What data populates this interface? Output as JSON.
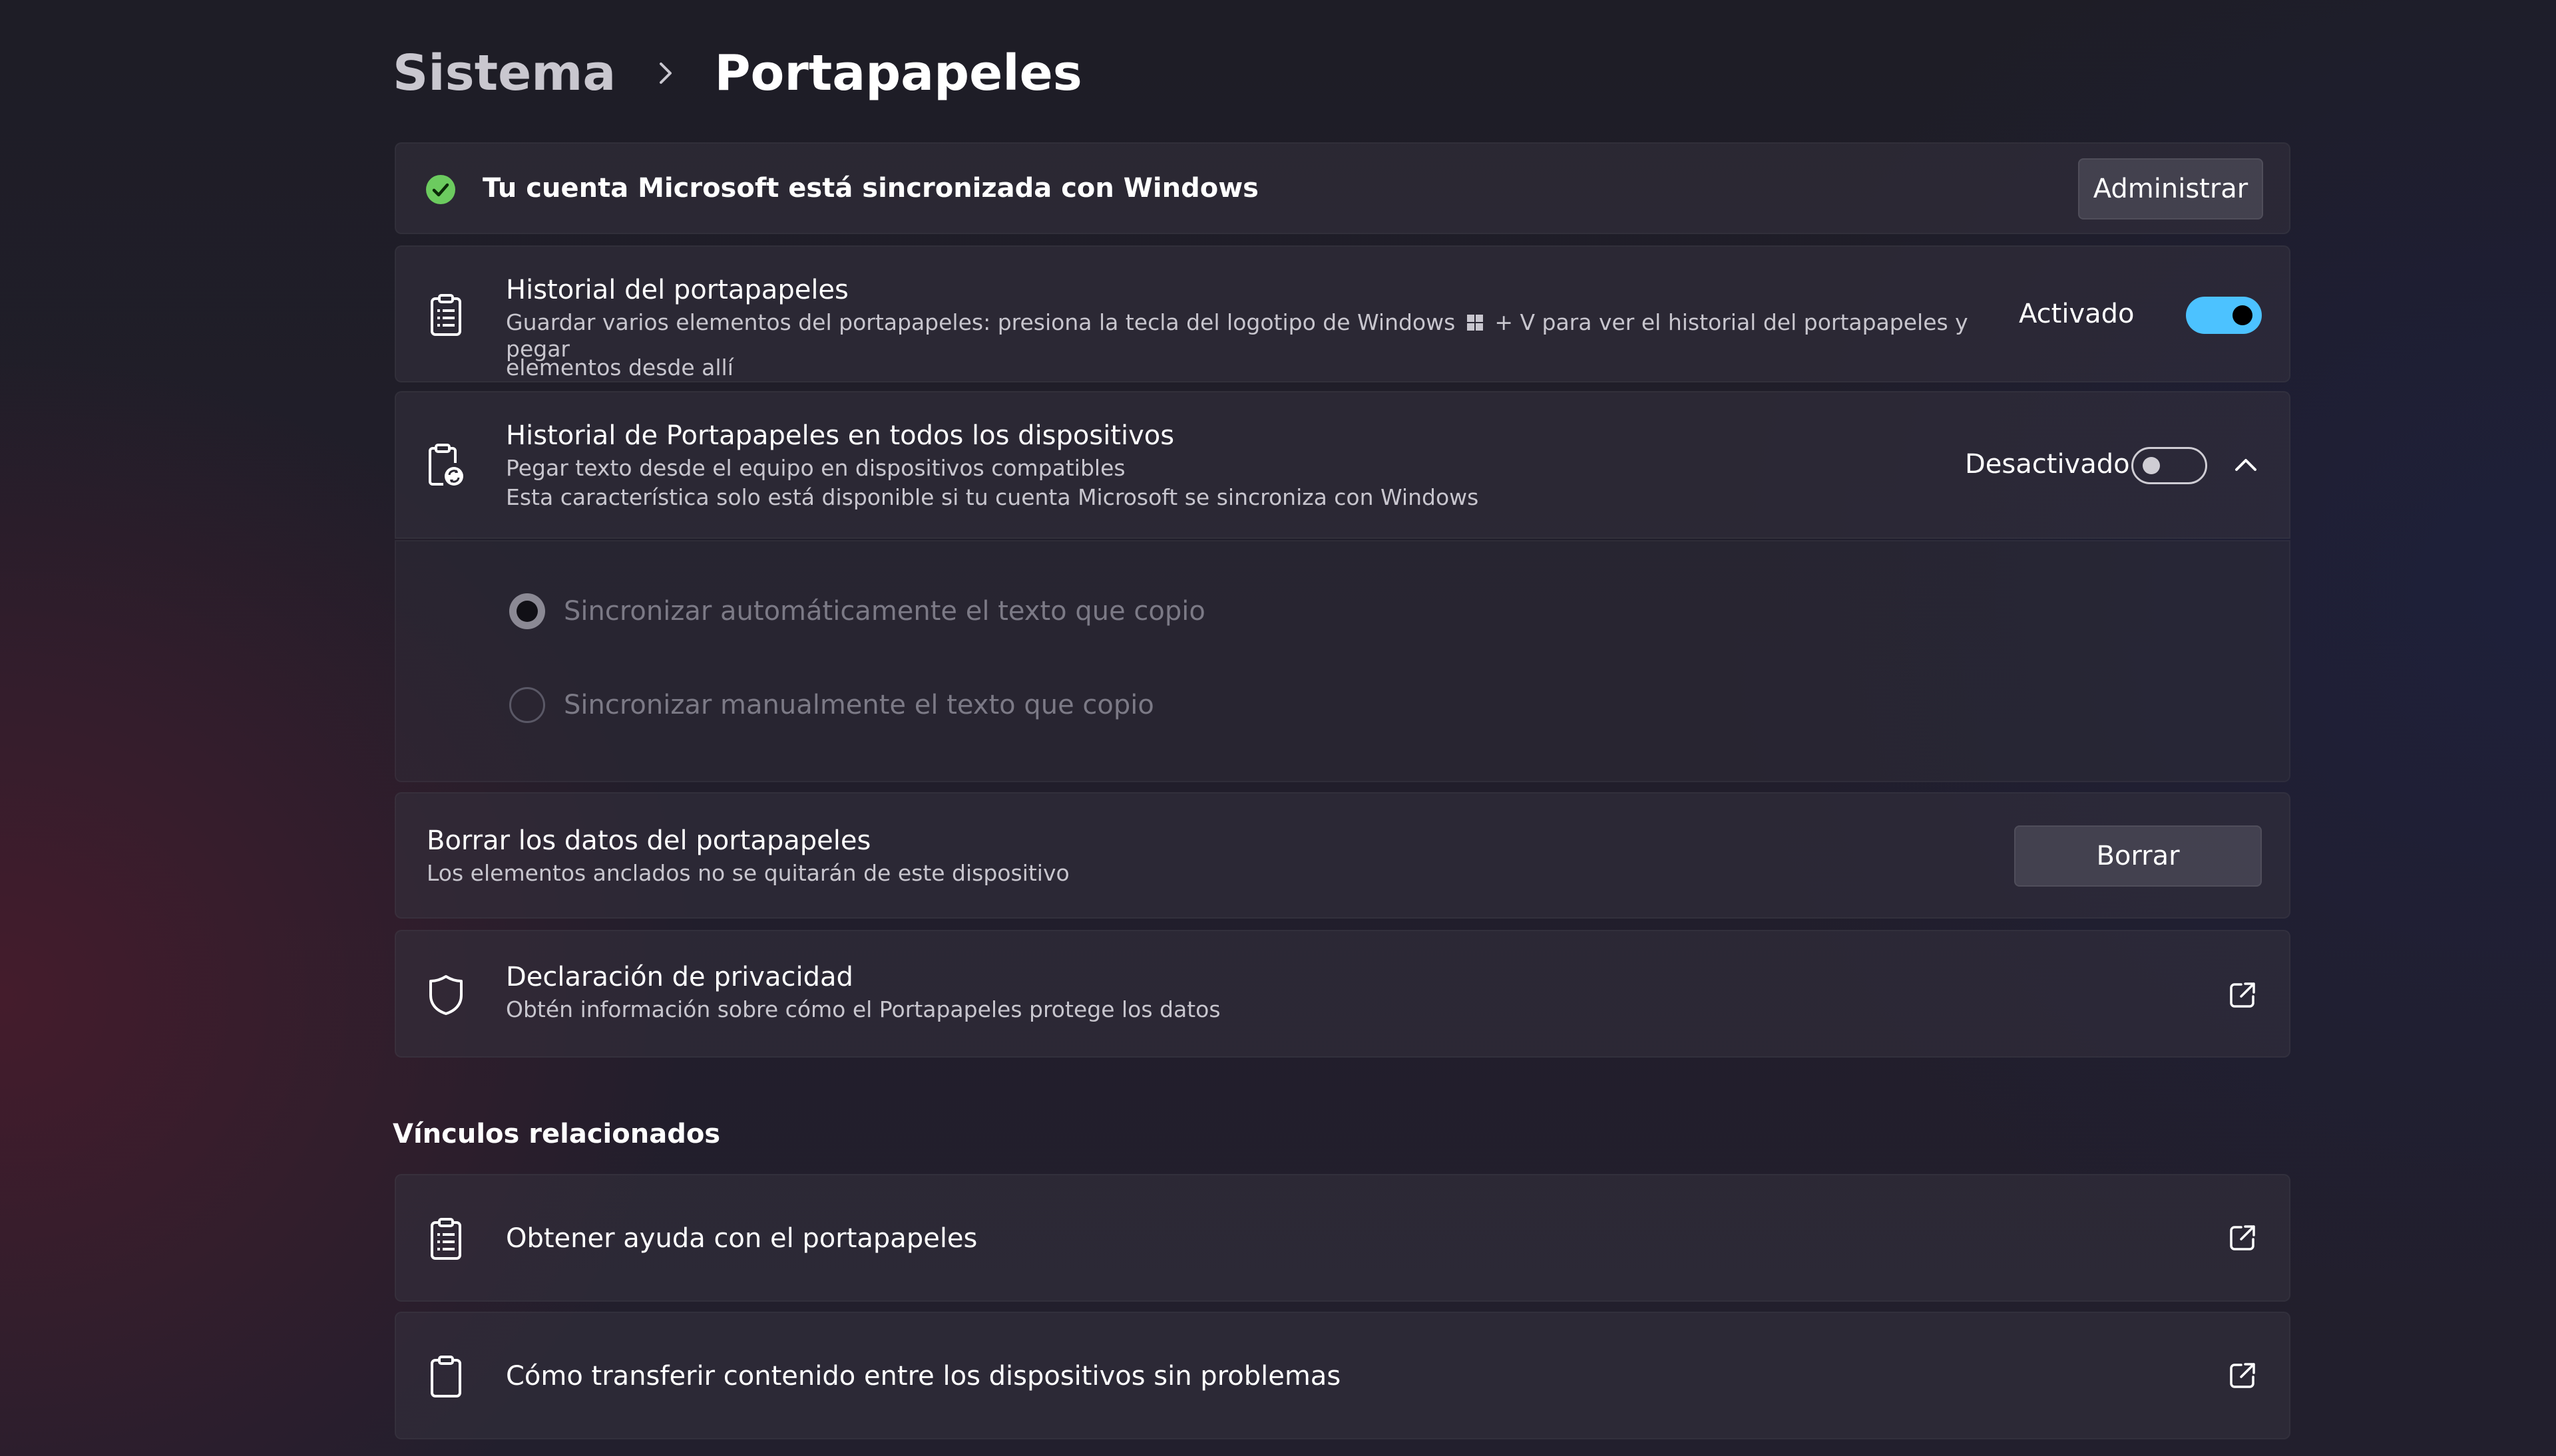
{
  "breadcrumb": {
    "parent": "Sistema",
    "current": "Portapapeles"
  },
  "account_banner": {
    "text": "Tu cuenta Microsoft está sincronizada con Windows",
    "button_label": "Administrar",
    "status_color": "#6ccb5f"
  },
  "clipboard_history": {
    "title": "Historial del portapapeles",
    "description_part1": "Guardar varios elementos del portapapeles: presiona la tecla del logotipo de Windows",
    "description_part2": "+ V para ver el historial del portapapeles y pegar",
    "description_line2": "elementos desde allí",
    "state_label": "Activado",
    "toggle_on": true,
    "accent_color": "#4cc2ff"
  },
  "cross_device": {
    "title": "Historial de Portapapeles en todos los dispositivos",
    "description_line1": "Pegar texto desde el equipo en dispositivos compatibles",
    "description_line2": "Esta característica solo está disponible si tu cuenta Microsoft se sincroniza con Windows",
    "state_label": "Desactivado",
    "toggle_on": false,
    "expanded": true,
    "options": [
      {
        "label": "Sincronizar automáticamente el texto que copio",
        "checked": true
      },
      {
        "label": "Sincronizar manualmente el texto que copio",
        "checked": false
      }
    ]
  },
  "clear_data": {
    "title": "Borrar los datos del portapapeles",
    "description": "Los elementos anclados no se quitarán de este dispositivo",
    "button_label": "Borrar"
  },
  "privacy": {
    "title": "Declaración de privacidad",
    "description": "Obtén información sobre cómo el Portapapeles protege los datos"
  },
  "related_links": {
    "heading": "Vínculos relacionados",
    "items": [
      {
        "label": "Obtener ayuda con el portapapeles",
        "icon": "clipboard-list-icon"
      },
      {
        "label": "Cómo transferir contenido entre los dispositivos sin problemas",
        "icon": "clipboard-icon"
      }
    ]
  }
}
